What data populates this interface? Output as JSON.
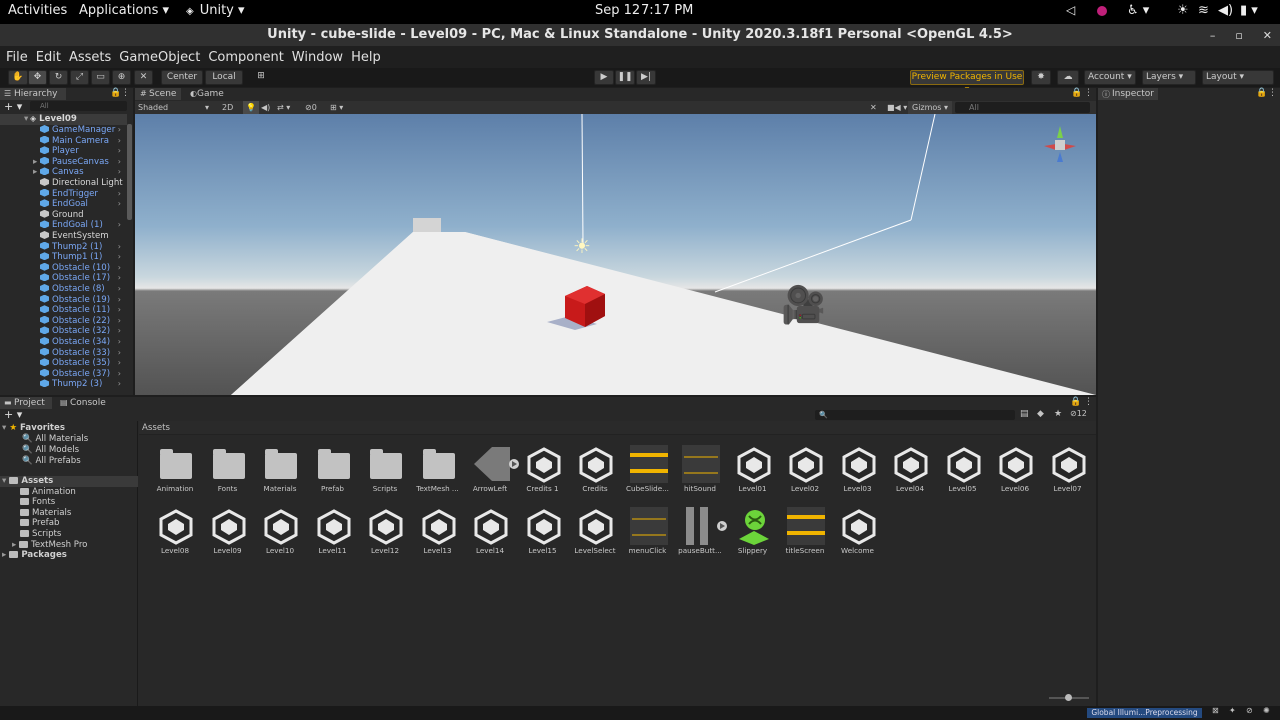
{
  "system_bar": {
    "activities": "Activities",
    "applications": "Applications ▾",
    "app": "Unity ▾",
    "date": "Sep 12",
    "time": "7:17 PM"
  },
  "window": {
    "title": "Unity - cube-slide - Level09 - PC, Mac & Linux Standalone - Unity 2020.3.18f1 Personal <OpenGL 4.5>",
    "controls": [
      "–",
      "▫",
      "✕"
    ]
  },
  "menu": [
    "File",
    "Edit",
    "Assets",
    "GameObject",
    "Component",
    "Window",
    "Help"
  ],
  "toolbar": {
    "center": "Center",
    "local": "Local",
    "preview_packages": "Preview Packages in Use ▾",
    "account": "Account",
    "layers": "Layers",
    "layout": "Layout"
  },
  "hierarchy": {
    "tab": "Hierarchy",
    "search_placeholder": "All",
    "root": "Level09",
    "items": [
      {
        "label": "GameManager",
        "prefab": true,
        "arrow": true
      },
      {
        "label": "Main Camera",
        "prefab": true,
        "arrow": true
      },
      {
        "label": "Player",
        "prefab": true,
        "arrow": true
      },
      {
        "label": "PauseCanvas",
        "prefab": true,
        "arrow": true
      },
      {
        "label": "Canvas",
        "prefab": true,
        "arrow": true
      },
      {
        "label": "Directional Light",
        "prefab": false,
        "arrow": false
      },
      {
        "label": "EndTrigger",
        "prefab": true,
        "arrow": true
      },
      {
        "label": "EndGoal",
        "prefab": true,
        "arrow": true
      },
      {
        "label": "Ground",
        "prefab": false,
        "arrow": false
      },
      {
        "label": "EndGoal (1)",
        "prefab": true,
        "arrow": true
      },
      {
        "label": "EventSystem",
        "prefab": false,
        "arrow": false
      },
      {
        "label": "Thump2 (1)",
        "prefab": true,
        "arrow": true
      },
      {
        "label": "Thump1 (1)",
        "prefab": true,
        "arrow": true
      },
      {
        "label": "Obstacle (10)",
        "prefab": true,
        "arrow": true
      },
      {
        "label": "Obstacle (17)",
        "prefab": true,
        "arrow": true
      },
      {
        "label": "Obstacle (8)",
        "prefab": true,
        "arrow": true
      },
      {
        "label": "Obstacle (19)",
        "prefab": true,
        "arrow": true
      },
      {
        "label": "Obstacle (11)",
        "prefab": true,
        "arrow": true
      },
      {
        "label": "Obstacle (22)",
        "prefab": true,
        "arrow": true
      },
      {
        "label": "Obstacle (32)",
        "prefab": true,
        "arrow": true
      },
      {
        "label": "Obstacle (34)",
        "prefab": true,
        "arrow": true
      },
      {
        "label": "Obstacle (33)",
        "prefab": true,
        "arrow": true
      },
      {
        "label": "Obstacle (35)",
        "prefab": true,
        "arrow": true
      },
      {
        "label": "Obstacle (37)",
        "prefab": true,
        "arrow": true
      },
      {
        "label": "Thump2 (3)",
        "prefab": true,
        "arrow": true
      }
    ]
  },
  "scene_view": {
    "tabs": [
      "Scene",
      "Game"
    ],
    "shading": "Shaded",
    "mode_2d": "2D",
    "hidden_count": "0",
    "gizmos": "Gizmos",
    "search_placeholder": "All"
  },
  "inspector": {
    "tab": "Inspector"
  },
  "project": {
    "tabs": [
      "Project",
      "Console"
    ],
    "hidden_count": "12",
    "breadcrumb": "Assets",
    "favorites": {
      "label": "Favorites",
      "items": [
        "All Materials",
        "All Models",
        "All Prefabs"
      ]
    },
    "assets_tree": {
      "label": "Assets",
      "items": [
        "Animation",
        "Fonts",
        "Materials",
        "Prefab",
        "Scripts",
        "TextMesh Pro"
      ]
    },
    "packages": "Packages",
    "assets": [
      {
        "label": "Animation",
        "kind": "folder"
      },
      {
        "label": "Fonts",
        "kind": "folder"
      },
      {
        "label": "Materials",
        "kind": "folder"
      },
      {
        "label": "Prefab",
        "kind": "folder"
      },
      {
        "label": "Scripts",
        "kind": "folder"
      },
      {
        "label": "TextMesh ...",
        "kind": "folder"
      },
      {
        "label": "ArrowLeft",
        "kind": "sprite"
      },
      {
        "label": "Credits 1",
        "kind": "unity"
      },
      {
        "label": "Credits",
        "kind": "unity"
      },
      {
        "label": "CubeSlide...",
        "kind": "audio"
      },
      {
        "label": "hitSound",
        "kind": "audio-dark"
      },
      {
        "label": "Level01",
        "kind": "unity"
      },
      {
        "label": "Level02",
        "kind": "unity"
      },
      {
        "label": "Level03",
        "kind": "unity"
      },
      {
        "label": "Level04",
        "kind": "unity"
      },
      {
        "label": "Level05",
        "kind": "unity"
      },
      {
        "label": "Level06",
        "kind": "unity"
      },
      {
        "label": "Level07",
        "kind": "unity"
      },
      {
        "label": "Level08",
        "kind": "unity"
      },
      {
        "label": "Level09",
        "kind": "unity"
      },
      {
        "label": "Level10",
        "kind": "unity"
      },
      {
        "label": "Level11",
        "kind": "unity"
      },
      {
        "label": "Level12",
        "kind": "unity"
      },
      {
        "label": "Level13",
        "kind": "unity"
      },
      {
        "label": "Level14",
        "kind": "unity"
      },
      {
        "label": "Level15",
        "kind": "unity"
      },
      {
        "label": "LevelSelect",
        "kind": "unity"
      },
      {
        "label": "menuClick",
        "kind": "audio-dark"
      },
      {
        "label": "pauseButt...",
        "kind": "pause"
      },
      {
        "label": "Slippery",
        "kind": "physics"
      },
      {
        "label": "titleScreen",
        "kind": "audio"
      },
      {
        "label": "Welcome",
        "kind": "unity"
      }
    ]
  },
  "status": {
    "lighting": "Global Illumi...Preprocessing"
  },
  "colors": {
    "accent": "#f0b400",
    "prefab": "#7aa7f5",
    "panel": "#282828"
  }
}
